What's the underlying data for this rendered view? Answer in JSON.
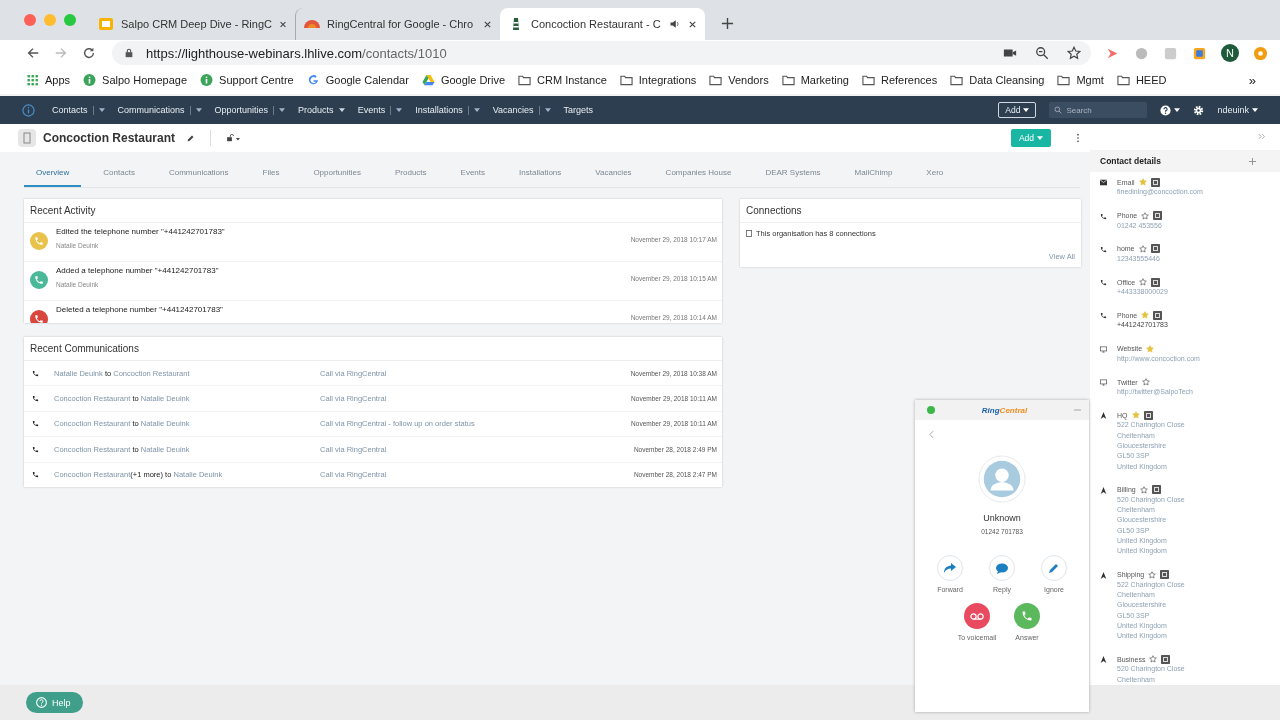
{
  "browser": {
    "tabs": [
      {
        "title": "Salpo CRM Deep Dive - RingC",
        "kind": "slides",
        "selected": false,
        "audio": false
      },
      {
        "title": "RingCentral for Google - Chro",
        "kind": "ringcentral",
        "selected": false,
        "audio": false
      },
      {
        "title": "Concoction Restaurant - C",
        "kind": "lighthouse",
        "selected": true,
        "audio": true
      }
    ],
    "url_host": "https://lighthouse-webinars.lhlive.com",
    "url_path": "/contacts/1010",
    "profile_initial": "N",
    "bookmarks": [
      {
        "label": "Apps",
        "kind": "apps"
      },
      {
        "label": "Salpo Homepage",
        "kind": "info"
      },
      {
        "label": "Support Centre",
        "kind": "info"
      },
      {
        "label": "Google Calendar",
        "kind": "google"
      },
      {
        "label": "Google Drive",
        "kind": "drive"
      },
      {
        "label": "CRM Instance",
        "kind": "folder"
      },
      {
        "label": "Integrations",
        "kind": "folder"
      },
      {
        "label": "Vendors",
        "kind": "folder"
      },
      {
        "label": "Marketing",
        "kind": "folder"
      },
      {
        "label": "References",
        "kind": "folder"
      },
      {
        "label": "Data Cleansing",
        "kind": "folder"
      },
      {
        "label": "Mgmt",
        "kind": "folder"
      },
      {
        "label": "HEED",
        "kind": "folder"
      }
    ],
    "more": "»"
  },
  "nav": {
    "items": [
      {
        "label": "Contacts",
        "kind": "split"
      },
      {
        "label": "Communications",
        "kind": "split"
      },
      {
        "label": "Opportunities",
        "kind": "split"
      },
      {
        "label": "Products",
        "kind": "caret"
      },
      {
        "label": "Events",
        "kind": "split"
      },
      {
        "label": "Installations",
        "kind": "split"
      },
      {
        "label": "Vacancies",
        "kind": "split"
      },
      {
        "label": "Targets",
        "kind": "plain"
      }
    ],
    "add": "Add",
    "search_placeholder": "Search",
    "user": "ndeuink"
  },
  "record": {
    "title": "Concoction Restaurant",
    "add": "Add",
    "tabs": [
      {
        "label": "Overview",
        "selected": true
      },
      {
        "label": "Contacts",
        "selected": false
      },
      {
        "label": "Communications",
        "selected": false
      },
      {
        "label": "Files",
        "selected": false
      },
      {
        "label": "Opportunities",
        "selected": false
      },
      {
        "label": "Products",
        "selected": false
      },
      {
        "label": "Events",
        "selected": false
      },
      {
        "label": "Installations",
        "selected": false
      },
      {
        "label": "Vacancies",
        "selected": false
      },
      {
        "label": "Companies House",
        "selected": false
      },
      {
        "label": "DEAR Systems",
        "selected": false
      },
      {
        "label": "MailChimp",
        "selected": false
      },
      {
        "label": "Xero",
        "selected": false
      }
    ]
  },
  "recent_activity": {
    "title": "Recent Activity",
    "items": [
      {
        "text": "Edited the telephone number \"+441242701783\"",
        "author": "Natalie Deuink",
        "time": "November 29, 2018 10:17 AM",
        "color": "#e8c24a"
      },
      {
        "text": "Added a telephone number \"+441242701783\"",
        "author": "Natalie Deuink",
        "time": "November 29, 2018 10:15 AM",
        "color": "#4cb89a"
      },
      {
        "text": "Deleted a telephone number \"+441242701783\"",
        "time": "November 29, 2018 10:14 AM",
        "color": "#d9463e"
      }
    ]
  },
  "connections": {
    "title": "Connections",
    "text": "This organisation has 8 connections",
    "link": "View All"
  },
  "recent_communications": {
    "title": "Recent Communications",
    "rows": [
      {
        "from": "Natalie Deuink",
        "joiner": "to",
        "to": "Concoction Restaurant",
        "subject": "Call via RingCentral",
        "time": "November 29, 2018 10:38 AM"
      },
      {
        "from": "Concoction Restaurant",
        "joiner": "to",
        "to": "Natalie Deuink",
        "subject": "Call via RingCentral",
        "time": "November 29, 2018 10:11 AM"
      },
      {
        "from": "Concoction Restaurant",
        "joiner": "to",
        "to": "Natalie Deuink",
        "subject": "Call via RingCentral - follow up on order status",
        "time": "November 29, 2018 10:11 AM"
      },
      {
        "from": "Concoction Restaurant",
        "joiner": "to",
        "to": "Natalie Deuink",
        "subject": "Call via RingCentral",
        "time": "November 28, 2018 2:49 PM"
      },
      {
        "from": "Concoction Restaurant",
        "extra": "(+1 more)",
        "joiner": "to",
        "to": "Natalie Deuink",
        "subject": "Call via RingCentral",
        "time": "November 28, 2018 2:47 PM"
      }
    ]
  },
  "contact_details": {
    "title": "Contact details",
    "items": [
      {
        "kind": "email",
        "label": "Email",
        "starred": true,
        "google": true,
        "lines": [
          "finedining@concoction.com"
        ]
      },
      {
        "kind": "phone",
        "label": "Phone",
        "starred": false,
        "google": true,
        "lines": [
          "01242 453556"
        ]
      },
      {
        "kind": "phone",
        "label": "home",
        "starred": false,
        "google": true,
        "lines": [
          "12343555446"
        ]
      },
      {
        "kind": "phone",
        "label": "Office",
        "starred": false,
        "google": true,
        "lines": [
          "+443338000029"
        ]
      },
      {
        "kind": "phone",
        "label": "Phone",
        "starred": true,
        "google": true,
        "lines": [
          "+441242701783"
        ]
      },
      {
        "kind": "web",
        "label": "Website",
        "starred": true,
        "google": false,
        "lines": [
          "http://www.concoction.com"
        ]
      },
      {
        "kind": "web",
        "label": "Twitter",
        "starred": false,
        "google": false,
        "lines": [
          "http://twitter@SalpoTech"
        ]
      },
      {
        "kind": "address",
        "label": "HQ",
        "starred": true,
        "google": true,
        "lines": [
          "522 Charington Close",
          "Cheltenham",
          "Gloucestershire",
          "GL50 3SP",
          "United Kingdom"
        ]
      },
      {
        "kind": "address",
        "label": "Billing",
        "starred": false,
        "google": true,
        "lines": [
          "520 Charington Close",
          "Cheltenham",
          "Gloucestershire",
          "GL50 3SP",
          "United Kingdom",
          "United Kingdom"
        ]
      },
      {
        "kind": "address",
        "label": "Shipping",
        "starred": false,
        "google": true,
        "lines": [
          "522 Charington Close",
          "Cheltenham",
          "Gloucestershire",
          "GL50 3SP",
          "United Kingdom",
          "United Kingdom"
        ]
      },
      {
        "kind": "address",
        "label": "Business",
        "starred": false,
        "google": true,
        "lines": [
          "520 Charington Close",
          "Cheltenham"
        ]
      }
    ]
  },
  "phone_widget": {
    "brand": [
      "Ring",
      "Central"
    ],
    "caller": "Unknown",
    "number": "01242 701783",
    "actions": [
      {
        "label": "Forward",
        "kind": "forward"
      },
      {
        "label": "Reply",
        "kind": "reply"
      },
      {
        "label": "Ignore",
        "kind": "ignore"
      }
    ],
    "call_actions": [
      {
        "label": "To voicemail",
        "kind": "voicemail"
      },
      {
        "label": "Answer",
        "kind": "answer"
      }
    ]
  },
  "help": "Help"
}
